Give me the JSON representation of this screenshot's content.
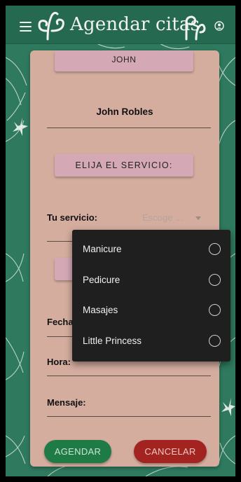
{
  "header": {
    "title": "Agendar citas",
    "menu_icon": "hamburger-menu-icon",
    "account_icon": "account-circle-icon"
  },
  "form": {
    "name_chip": "JOHN",
    "full_name": "John Robles",
    "service_chip": "ELIJA EL SERVICIO:",
    "service_label": "Tu servicio:",
    "service_placeholder": "Escoge ...",
    "fecha_label": "Fecha",
    "hora_label": "Hora:",
    "mensaje_label": "Mensaje:"
  },
  "dropdown": {
    "options": [
      {
        "label": "Manicure",
        "selected": false
      },
      {
        "label": "Pedicure",
        "selected": false
      },
      {
        "label": "Masajes",
        "selected": false
      },
      {
        "label": "Little Princess",
        "selected": false
      }
    ]
  },
  "actions": {
    "agendar": "AGENDAR",
    "cancelar": "CANCELAR"
  },
  "colors": {
    "background": "#2f7a5e",
    "header": "#256a50",
    "card": "#d4ad9f",
    "chip": "#d4a9b5",
    "agendar": "#1f7b46",
    "cancelar": "#a32320",
    "dropdown": "#1f1f1f"
  }
}
